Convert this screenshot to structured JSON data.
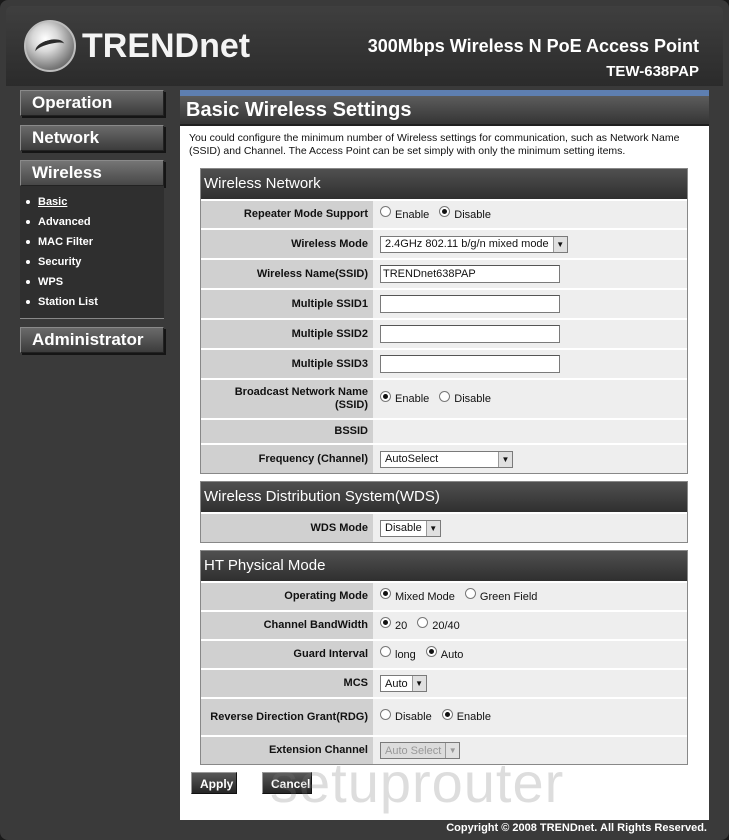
{
  "header": {
    "logo_text": "TRENDnet",
    "product_title": "300Mbps Wireless N PoE Access Point",
    "product_model": "TEW-638PAP"
  },
  "sidebar": {
    "items": [
      {
        "label": "Operation"
      },
      {
        "label": "Network"
      },
      {
        "label": "Wireless"
      },
      {
        "label": "Administrator"
      }
    ],
    "wireless_submenu": [
      {
        "label": "Basic",
        "current": true
      },
      {
        "label": "Advanced"
      },
      {
        "label": "MAC Filter"
      },
      {
        "label": "Security"
      },
      {
        "label": "WPS"
      },
      {
        "label": "Station List"
      }
    ]
  },
  "main": {
    "title": "Basic Wireless Settings",
    "intro": "You could configure the minimum number of Wireless settings for communication, such as Network Name (SSID) and Channel. The Access Point can be set simply with only the minimum setting items.",
    "wireless_network": {
      "heading": "Wireless Network",
      "repeater_mode_label": "Repeater Mode Support",
      "repeater_options": [
        "Enable",
        "Disable"
      ],
      "repeater_selected": "Disable",
      "wireless_mode_label": "Wireless Mode",
      "wireless_mode_value": "2.4GHz 802.11 b/g/n mixed mode",
      "ssid_label": "Wireless Name(SSID)",
      "ssid_value": "TRENDnet638PAP",
      "mssid1_label": "Multiple SSID1",
      "mssid1_value": "",
      "mssid2_label": "Multiple SSID2",
      "mssid2_value": "",
      "mssid3_label": "Multiple SSID3",
      "mssid3_value": "",
      "broadcast_label": "Broadcast Network Name (SSID)",
      "broadcast_options": [
        "Enable",
        "Disable"
      ],
      "broadcast_selected": "Enable",
      "bssid_label": "BSSID",
      "bssid_value": "",
      "frequency_label": "Frequency (Channel)",
      "frequency_value": "AutoSelect"
    },
    "wds": {
      "heading": "Wireless Distribution System(WDS)",
      "mode_label": "WDS Mode",
      "mode_value": "Disable"
    },
    "ht": {
      "heading": "HT Physical Mode",
      "operating_label": "Operating Mode",
      "operating_options": [
        "Mixed Mode",
        "Green Field"
      ],
      "operating_selected": "Mixed Mode",
      "bandwidth_label": "Channel BandWidth",
      "bandwidth_options": [
        "20",
        "20/40"
      ],
      "bandwidth_selected": "20",
      "guard_label": "Guard Interval",
      "guard_options": [
        "long",
        "Auto"
      ],
      "guard_selected": "Auto",
      "mcs_label": "MCS",
      "mcs_value": "Auto",
      "rdg_label": "Reverse Direction Grant(RDG)",
      "rdg_options": [
        "Disable",
        "Enable"
      ],
      "rdg_selected": "Enable",
      "ext_label": "Extension Channel",
      "ext_value": "Auto Select"
    },
    "buttons": {
      "apply": "Apply",
      "cancel": "Cancel"
    }
  },
  "footer": {
    "copyright": "Copyright © 2008 TRENDnet. All Rights Reserved."
  },
  "watermark": "setuprouter"
}
